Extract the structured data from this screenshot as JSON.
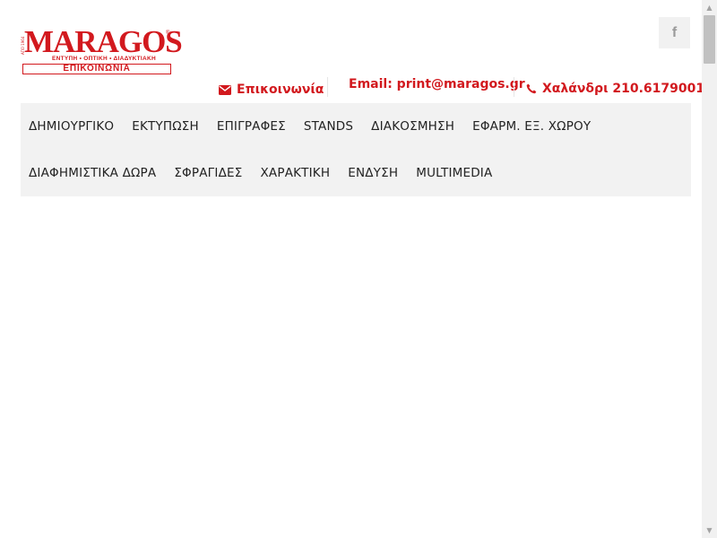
{
  "logo": {
    "brand": "MARAGOS",
    "registered_mark": "®",
    "side_text": "ΑΠΟ 1964",
    "tagline": "ΕΝΤΥΠΗ • ΟΠΤΙΚΗ • ΔΙΑΔΥΚΤΙΑΚΗ",
    "subtitle": "ΕΠΙΚΟΙΝΩΝΙΑ"
  },
  "social": {
    "facebook_icon": "facebook-icon",
    "facebook_glyph": "f"
  },
  "contact": {
    "link_label": "Επικοινωνία",
    "email_label": "Email: print@maragos.gr",
    "phone_label": "Χαλάνδρι 210.6179001"
  },
  "nav": {
    "row1": [
      "ΔΗΜΙΟΥΡΓΙΚΟ",
      "ΕΚΤΥΠΩΣΗ",
      "ΕΠΙΓΡΑΦΕΣ",
      "STANDS",
      "ΔΙΑΚΟΣΜΗΣΗ",
      "ΕΦΑΡΜ. ΕΞ. ΧΩΡΟΥ"
    ],
    "row2": [
      "ΔΙΑΦΗΜΙΣΤΙΚΑ ΔΩΡΑ",
      "ΣΦΡΑΓΙΔΕΣ",
      "ΧΑΡΑΚΤΙΚΗ",
      "ΕΝΔΥΣΗ",
      "MULTIMEDIA"
    ]
  },
  "colors": {
    "brand_red": "#d2191e",
    "nav_bg": "#f2f2f2",
    "nav_text": "#222222"
  }
}
